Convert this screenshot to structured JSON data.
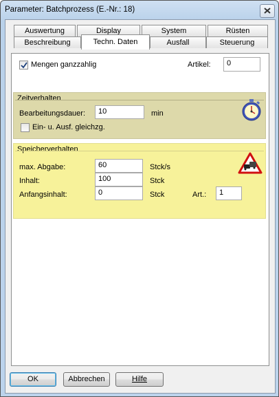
{
  "window": {
    "title": "Parameter: Batchprozess (E.-Nr.: 18)"
  },
  "tabs_row1": [
    "Auswertung",
    "Display",
    "System",
    "Rüsten"
  ],
  "tabs_row2": [
    "Beschreibung",
    "Techn. Daten",
    "Ausfall",
    "Steuerung"
  ],
  "active_tab": "Techn. Daten",
  "top": {
    "integer_label": "Mengen ganzzahlig",
    "integer_checked": true,
    "article_label": "Artikel:",
    "article_value": "0"
  },
  "zeit": {
    "title": "Zeitverhalten",
    "duration_label": "Bearbeitungsdauer:",
    "duration_value": "10",
    "duration_unit": "min",
    "sync_label": "Ein- u. Ausf. gleichzg.",
    "sync_checked": false,
    "icon": "stopwatch-icon"
  },
  "speicher": {
    "title": "Speicherverhalten",
    "max_label": "max. Abgabe:",
    "max_value": "60",
    "max_unit": "Stck/s",
    "content_label": "Inhalt:",
    "content_value": "100",
    "content_unit": "Stck",
    "initial_label": "Anfangsinhalt:",
    "initial_value": "0",
    "initial_unit": "Stck",
    "type_label": "Art.:",
    "type_value": "1",
    "icon": "traffic-jam-warning-icon"
  },
  "buttons": {
    "ok": "OK",
    "cancel": "Abbrechen",
    "help": "Hilfe"
  },
  "colors": {
    "zeit_bg": "#ddd9aa",
    "speicher_bg": "#f7f29a"
  }
}
